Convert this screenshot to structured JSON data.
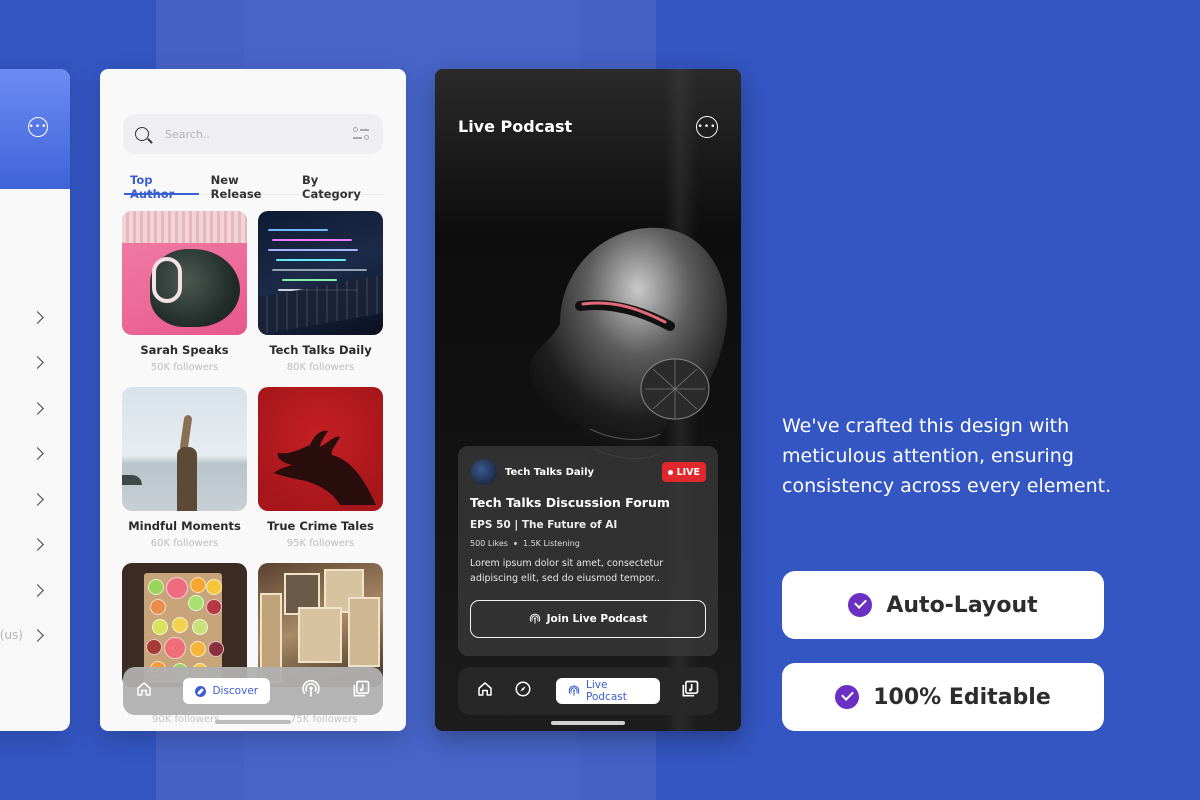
{
  "phone_settings": {
    "more_icon": "more-horizontal-icon",
    "rows": [
      {
        "extra": "",
        "icon": "chevron-right-icon"
      },
      {
        "extra": "",
        "icon": "chevron-right-icon"
      },
      {
        "extra": "",
        "icon": "chevron-right-icon"
      },
      {
        "extra": "",
        "icon": "chevron-right-icon"
      },
      {
        "extra": "",
        "icon": "chevron-right-icon"
      },
      {
        "extra": "",
        "icon": "chevron-right-icon"
      },
      {
        "extra": "",
        "icon": "chevron-right-icon"
      },
      {
        "extra": "(us)",
        "icon": "chevron-right-icon"
      }
    ]
  },
  "phone_discover": {
    "search": {
      "placeholder": "Search..",
      "icon": "search-icon",
      "filter_icon": "filter-sliders-icon"
    },
    "tabs": [
      {
        "label": "Top Author",
        "active": true
      },
      {
        "label": "New Release",
        "active": false
      },
      {
        "label": "By Category",
        "active": false
      }
    ],
    "authors": [
      {
        "name": "Sarah Speaks",
        "followers": "50K followers"
      },
      {
        "name": "Tech Talks Daily",
        "followers": "80K followers"
      },
      {
        "name": "Mindful Moments",
        "followers": "60K followers"
      },
      {
        "name": "True Crime Tales",
        "followers": "95K followers"
      },
      {
        "name": "",
        "followers": "90K followers"
      },
      {
        "name": "",
        "followers": "75K followers"
      }
    ],
    "nav": {
      "home_icon": "home-icon",
      "active_label": "Discover",
      "active_icon": "compass-icon",
      "podcast_icon": "podcast-icon",
      "library_icon": "music-library-icon"
    }
  },
  "phone_live": {
    "title": "Live Podcast",
    "more_icon": "more-horizontal-icon",
    "card": {
      "source": "Tech Talks Daily",
      "badge": "LIVE",
      "title": "Tech Talks Discussion Forum",
      "episode": "EPS 50 | The Future of AI",
      "likes": "500 Likes",
      "listening": "1.5K Listening",
      "description": "Lorem ipsum dolor sit amet, consectetur adipiscing elit, sed do eiusmod tempor..",
      "button_label": "Join Live Podcast"
    },
    "nav": {
      "home_icon": "home-icon",
      "discover_icon": "compass-icon",
      "active_label": "Live Podcast",
      "active_icon": "podcast-icon",
      "library_icon": "music-library-icon"
    }
  },
  "marketing": {
    "tagline": "We've crafted this design with meticulous attention, ensuring consistency across every element.",
    "features": [
      {
        "label": "Auto-Layout",
        "icon": "check-circle-icon"
      },
      {
        "label": "100% Editable",
        "icon": "check-circle-icon"
      }
    ]
  },
  "colors": {
    "background": "#3356c2",
    "accent_blue": "#3b5fd0",
    "live_red": "#e0282e",
    "check_purple": "#6b2fc4"
  }
}
